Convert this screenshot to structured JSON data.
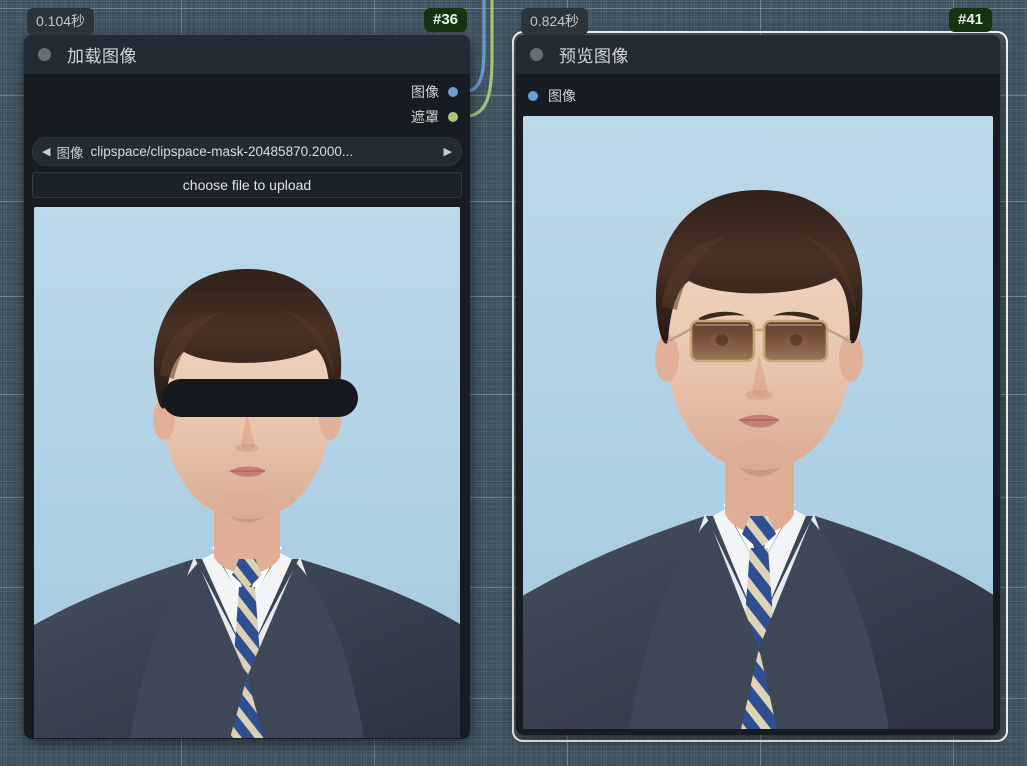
{
  "app": {
    "canvas_bg": "#3e505d",
    "grid_line_color": "#d7e4ee"
  },
  "nodes": [
    {
      "id": "node-load-image",
      "exec_time": "0.104秒",
      "badge": "#36",
      "title": "加载图像",
      "selected": false,
      "outputs": [
        {
          "label": "图像",
          "color": "#6a9ed4"
        },
        {
          "label": "遮罩",
          "color": "#a9c876"
        }
      ],
      "inputs": [],
      "widgets": [
        {
          "type": "combo",
          "key": "图像",
          "value": "clipspace/clipspace-mask-20485870.2000...",
          "left_arrow": "◀",
          "right_arrow": "▶"
        },
        {
          "type": "button",
          "label": "choose file to upload"
        }
      ],
      "preview": {
        "alt": "证件照 蓝底 西装 男士 眼部被黑色遮罩条遮挡",
        "bg": "#b3d2e6",
        "has_mask_bar": true,
        "mask_bar_color": "#15181f"
      }
    },
    {
      "id": "node-preview-image",
      "exec_time": "0.824秒",
      "badge": "#41",
      "title": "预览图像",
      "selected": true,
      "outputs": [],
      "inputs": [
        {
          "label": "图像",
          "color": "#6a9ed4"
        }
      ],
      "widgets": [],
      "preview": {
        "alt": "证件照 蓝底 西装 男士 戴棕色墨镜",
        "bg": "#b3d2e6",
        "has_mask_bar": false,
        "mask_bar_color": ""
      }
    }
  ],
  "links": [
    {
      "from": "加载图像.图像",
      "to": "上方节点",
      "color": "#6a9ed4"
    },
    {
      "from": "加载图像.遮罩",
      "to": "上方节点",
      "color": "#a9c876"
    }
  ]
}
